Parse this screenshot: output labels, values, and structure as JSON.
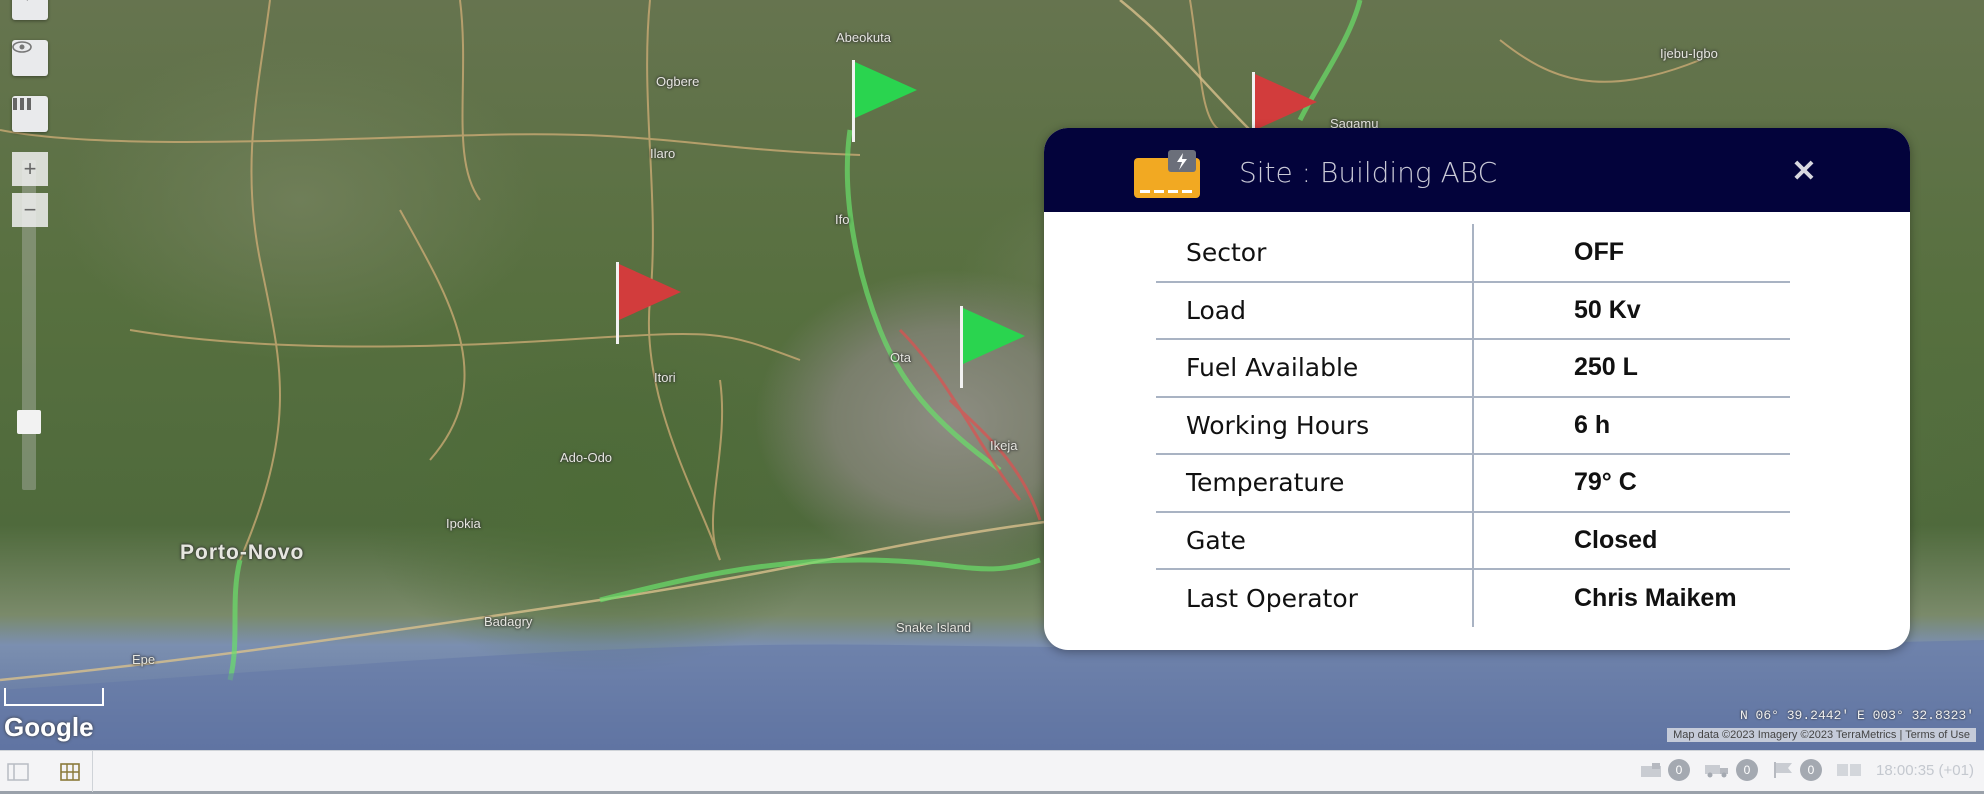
{
  "map": {
    "places": [
      {
        "name": "Ijebu-Igbo",
        "cls": ""
      },
      {
        "name": "Porto-Novo",
        "cls": "big"
      },
      {
        "name": "Epe",
        "cls": ""
      },
      {
        "name": "Snake Island",
        "cls": ""
      },
      {
        "name": "Ado-Odo",
        "cls": ""
      },
      {
        "name": "Ipokia",
        "cls": ""
      },
      {
        "name": "Itori",
        "cls": ""
      },
      {
        "name": "Ilaro",
        "cls": ""
      },
      {
        "name": "Ifo",
        "cls": ""
      },
      {
        "name": "Sagamu",
        "cls": ""
      },
      {
        "name": "Ogbere",
        "cls": ""
      },
      {
        "name": "Ota",
        "cls": ""
      },
      {
        "name": "Ikeja",
        "cls": ""
      },
      {
        "name": "Badagry",
        "cls": ""
      },
      {
        "name": "Abeokuta",
        "cls": ""
      }
    ],
    "google_label": "Google",
    "coordinates": "N 06° 39.2442' E 003° 32.8323'",
    "attribution": "Map data ©2023 Imagery ©2023 TerraMetrics | Terms of Use",
    "flags": [
      {
        "status": "green"
      },
      {
        "status": "red"
      },
      {
        "status": "red"
      },
      {
        "status": "green"
      }
    ]
  },
  "popup": {
    "icon": "generator-icon",
    "title": "Site : Building ABC",
    "close_label": "✕",
    "rows": [
      {
        "label": "Sector",
        "value": "OFF"
      },
      {
        "label": "Load",
        "value": "50 Kv"
      },
      {
        "label": "Fuel Available",
        "value": "250 L"
      },
      {
        "label": "Working Hours",
        "value": "6 h"
      },
      {
        "label": "Temperature",
        "value": "79° C"
      },
      {
        "label": "Gate",
        "value": "Closed"
      },
      {
        "label": "Last Operator",
        "value": "Chris Maikem"
      }
    ]
  },
  "bottom_bar": {
    "counters": [
      {
        "icon": "generator-icon",
        "count": "0"
      },
      {
        "icon": "truck-icon",
        "count": "0"
      },
      {
        "icon": "flag-icon",
        "count": "0"
      }
    ],
    "time": "18:00:35 (+01)"
  },
  "colors": {
    "header_bg": "#03033b",
    "flag_green": "#2ad44f",
    "flag_red": "#d23c3c",
    "generator_orange": "#f2a922"
  }
}
